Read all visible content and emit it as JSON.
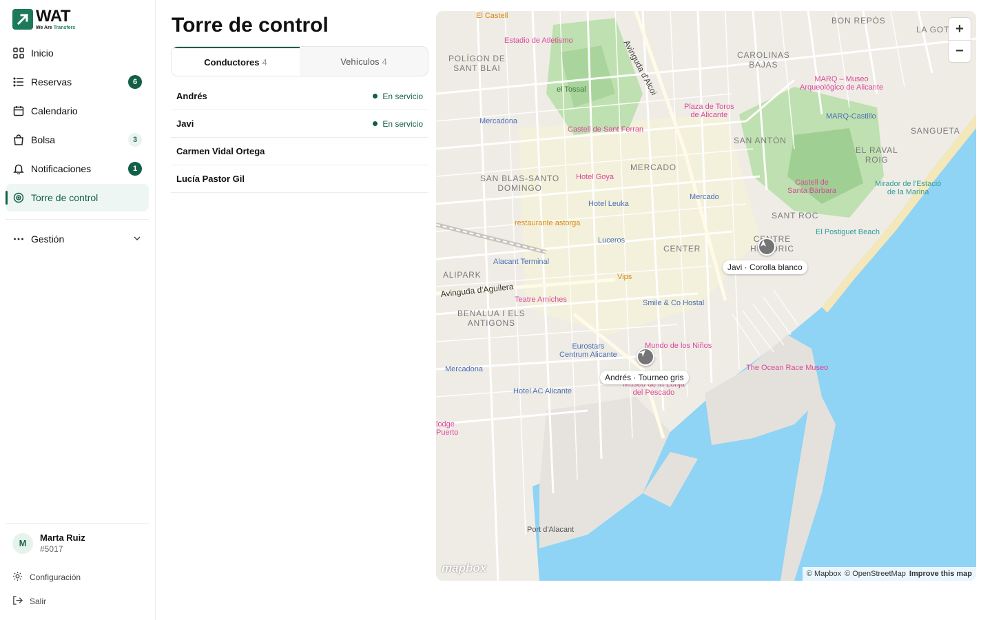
{
  "app": {
    "logo_word": "WAT",
    "logo_tag_prefix": "We Are",
    "logo_tag_accent": "Transfers",
    "accent_color": "#135f47"
  },
  "sidebar": {
    "items": [
      {
        "label": "Inicio",
        "icon": "grid-icon",
        "badge": ""
      },
      {
        "label": "Reservas",
        "icon": "list-icon",
        "badge": "6"
      },
      {
        "label": "Calendario",
        "icon": "calendar-icon",
        "badge": ""
      },
      {
        "label": "Bolsa",
        "icon": "bag-icon",
        "badge": "3"
      },
      {
        "label": "Notificaciones",
        "icon": "bell-icon",
        "badge": "1"
      },
      {
        "label": "Torre de control",
        "icon": "target-icon",
        "badge": "",
        "active": true
      }
    ],
    "gestion": {
      "label": "Gestión",
      "icon": "more-icon"
    },
    "user": {
      "initial": "M",
      "name": "Marta Ruiz",
      "id": "#5017"
    },
    "settings_label": "Configuración",
    "logout_label": "Salir"
  },
  "main": {
    "title": "Torre de control",
    "tabs": [
      {
        "label": "Conductores",
        "count": "4",
        "active": true
      },
      {
        "label": "Vehículos",
        "count": "4",
        "active": false
      }
    ],
    "drivers": [
      {
        "name": "Andrés",
        "status": "En servicio"
      },
      {
        "name": "Javi",
        "status": "En servicio"
      },
      {
        "name": "Carmen Vidal Ortega",
        "status": ""
      },
      {
        "name": "Lucía Pastor Gil",
        "status": ""
      }
    ]
  },
  "map": {
    "zoom_in": "+",
    "zoom_out": "−",
    "attribution": [
      "© Mapbox",
      "© OpenStreetMap",
      "Improve this map"
    ],
    "logo": "mapbox",
    "vehicles": [
      {
        "label": "Javi · Corolla blanco"
      },
      {
        "label": "Andrés · Tourneo gris"
      }
    ],
    "labels": {
      "castell": "El Castell",
      "estadio": "Estadio de Atletismo",
      "poligon": "POLÍGON DE\nSANT BLAI",
      "tossal": "el Tossal",
      "avinguda_alcoi": "Avinguda d'Alcoi",
      "carolinas": "CAROLINAS\nBAJAS",
      "bon_repos": "BON REPÒS",
      "la_goteta": "LA GOT",
      "marq": "MARQ – Museo\nArqueológico de Alicante",
      "plaza_toros": "Plaza de Toros\nde Alicante",
      "mercadona1": "Mercadona",
      "castell_ferran": "Castell de Sant Ferran",
      "marq_castillo": "MARQ-Castillo",
      "sangueta": "SANGUETA",
      "san_anton": "SAN ANTÓN",
      "el_raval": "EL RAVAL\nROIG",
      "mercado": "MERCADO",
      "san_blas": "SAN BLAS-SANTO\nDOMINGO",
      "hotel_goya": "Hotel Goya",
      "mercado_stop": "Mercado",
      "castell_barbara": "Castell de\nSanta Bàrbara",
      "mirador": "Mirador de l'Estació\nde la Marina",
      "hotel_leuka": "Hotel Leuka",
      "sant_roc": "SANT ROC",
      "restaurante": "restaurante astorga",
      "postiguet": "El Postiguet Beach",
      "luceros": "Luceros",
      "center": "CENTER",
      "centre_historic": "CENTRE\nHISTÒRIC",
      "alacant_terminal": "Alacant Terminal",
      "vips": "Vips",
      "alipark": "ALIPARK",
      "aguilera": "Avinguda d'Aguilera",
      "teatre": "Teatre Arniches",
      "smile": "Smile & Co Hostal",
      "benalua": "BENALUA I ELS\nANTIGONS",
      "mundo": "Mundo de los Niños",
      "eurostars": "Eurostars\nCentrum Alicante",
      "ocean_race": "The Ocean Race Museo",
      "mercadona2": "Mercadona",
      "lonja": "Museo de la Lonja\ndel Pescado",
      "hotel_ac": "Hotel AC Alicante",
      "lodge": "lodge\nPuerto",
      "port": "Port d'Alacant"
    }
  }
}
